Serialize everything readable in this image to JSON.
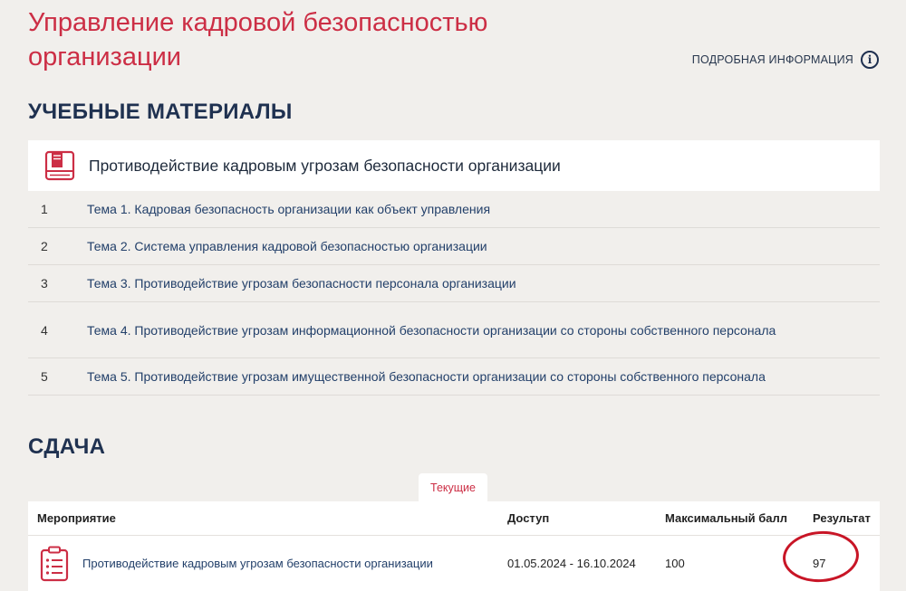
{
  "course": {
    "title": "Управление кадровой безопасностью организации"
  },
  "more_info": {
    "label": "ПОДРОБНАЯ ИНФОРМАЦИЯ",
    "icon": "info-circle-icon"
  },
  "materials": {
    "heading": "УЧЕБНЫЕ МАТЕРИАЛЫ",
    "card_title": "Противодействие кадровым угрозам безопасности организации",
    "card_icon": "book-icon",
    "topics": [
      {
        "num": "1",
        "label": "Тема 1. Кадровая безопасность организации как объект управления"
      },
      {
        "num": "2",
        "label": "Тема 2. Система управления кадровой безопасностью организации"
      },
      {
        "num": "3",
        "label": "Тема 3. Противодействие угрозам безопасности персонала организации"
      },
      {
        "num": "4",
        "label": "Тема 4. Противодействие угрозам информационной безопасности организации со стороны собственного персонала"
      },
      {
        "num": "5",
        "label": "Тема 5. Противодействие угрозам имущественной безопасности организации со стороны собственного персонала"
      }
    ]
  },
  "submission": {
    "heading": "СДАЧА",
    "tabs": [
      {
        "label": "Текущие",
        "active": true
      }
    ],
    "columns": {
      "event": "Мероприятие",
      "access": "Доступ",
      "max_score": "Максимальный балл",
      "result": "Результат"
    },
    "rows": [
      {
        "event": "Противодействие кадровым угрозам безопасности организации",
        "access": "01.05.2024 - 16.10.2024",
        "max_score": "100",
        "result": "97",
        "icon": "checklist-icon"
      }
    ]
  },
  "colors": {
    "accent": "#cc2e45",
    "heading": "#1f3150",
    "link": "#23406a",
    "background": "#f1efec",
    "annotation_circle": "#c81526"
  }
}
